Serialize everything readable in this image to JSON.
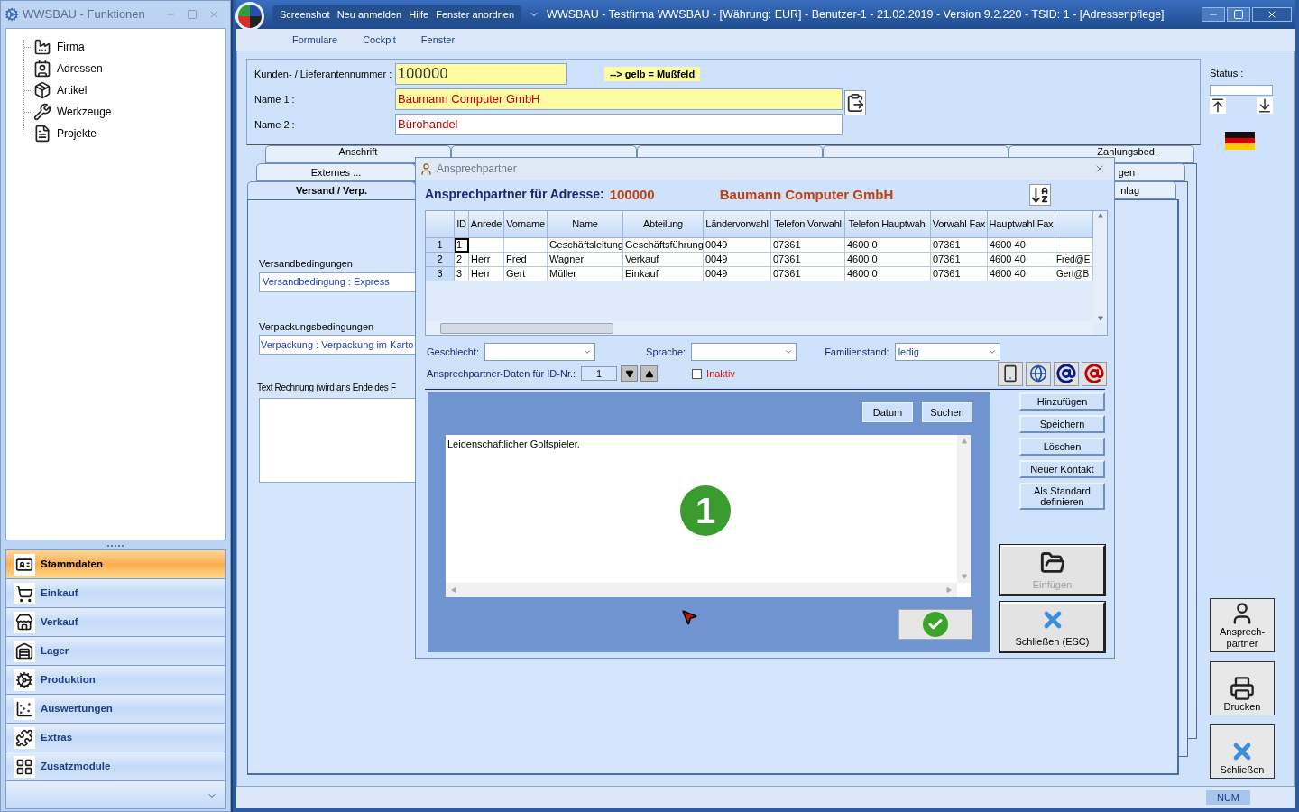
{
  "funktionen": {
    "title": "WWSBAU - Funktionen",
    "tree": [
      {
        "label": "Firma"
      },
      {
        "label": "Adressen"
      },
      {
        "label": "Artikel"
      },
      {
        "label": "Werkzeuge"
      },
      {
        "label": "Projekte"
      }
    ],
    "nav": [
      {
        "label": "Stammdaten",
        "selected": true
      },
      {
        "label": "Einkauf",
        "selected": false
      },
      {
        "label": "Verkauf",
        "selected": false
      },
      {
        "label": "Lager",
        "selected": false
      },
      {
        "label": "Produktion",
        "selected": false
      },
      {
        "label": "Auswertungen",
        "selected": false
      },
      {
        "label": "Extras",
        "selected": false
      },
      {
        "label": "Zusatzmodule",
        "selected": false
      }
    ]
  },
  "main": {
    "title_menu": [
      "Screenshot",
      "Neu anmelden",
      "Hilfe",
      "Fenster anordnen"
    ],
    "title": "WWSBAU - Testfirma WWSBAU - [Währung: EUR] - Benutzer-1 - 21.02.2019 - Version 9.2.220 - TSID: 1  - [Adressenpflege]",
    "menu": [
      "Formulare",
      "Cockpit",
      "Fenster"
    ],
    "form": {
      "customer_number": {
        "label": "Kunden- / Lieferantennummer :",
        "value": "100000"
      },
      "hint": "--> gelb = Mußfeld",
      "name1": {
        "label": "Name 1 :",
        "value": "Baumann Computer GmbH"
      },
      "name2": {
        "label": "Name 2 :",
        "value": "Bürohandel"
      },
      "status_label": "Status :"
    },
    "tab_rows": [
      [
        {
          "label": "Anschrift",
          "selected": false
        },
        {
          "selected": false
        },
        {
          "selected": false
        },
        {
          "selected": false
        },
        {
          "label": "Zahlungsbed.",
          "selected": false
        }
      ],
      [
        {
          "label": "Externes ...",
          "selected": false
        },
        {
          "label": "gen",
          "selected": false
        }
      ],
      [
        {
          "label": "Versand / Verp.",
          "selected": true
        },
        {
          "label": "nlag",
          "selected": false
        }
      ]
    ],
    "versand": {
      "shipping_label": "Versandbedingungen",
      "shipping_value": "Versandbedingung : Express",
      "packing_label": "Verpackungsbedingungen",
      "packing_value": "Verpackung :  Verpackung im Karto",
      "invoice_text_label": "Text Rechnung (wird ans Ende des F"
    },
    "side_buttons": [
      {
        "label": "Ansprech-partner",
        "kind": "person"
      },
      {
        "label": "Drucken",
        "kind": "print"
      },
      {
        "label": "Schließen",
        "kind": "close"
      }
    ],
    "status_bar": {
      "num": "NUM"
    }
  },
  "dialog": {
    "title": "Ansprechpartner",
    "header_label": "Ansprechpartner für Adresse:",
    "number": "100000",
    "company": "Baumann Computer GmbH",
    "columns": [
      {
        "label": "ID"
      },
      {
        "label": "Anrede"
      },
      {
        "label": "Vorname"
      },
      {
        "label": "Name"
      },
      {
        "label": "Abteilung"
      },
      {
        "label": "Ländervorwahl"
      },
      {
        "label": "Telefon Vorwahl"
      },
      {
        "label": "Telefon Hauptwahl"
      },
      {
        "label": "Vorwahl Fax"
      },
      {
        "label": "Hauptwahl Fax"
      }
    ],
    "rows": [
      {
        "number": "1",
        "focused": true,
        "cells": [
          "1",
          null,
          null,
          "Geschäftsleitung",
          "Geschäftsführung",
          "0049",
          "07361",
          "4600 0",
          "07361",
          "4600 40",
          null
        ]
      },
      {
        "number": "2",
        "focused": false,
        "cells": [
          "2",
          "Herr",
          "Fred",
          "Wagner",
          "Verkauf",
          "0049",
          "07361",
          "4600 0",
          "07361",
          "4600 40",
          "Fred@E"
        ]
      },
      {
        "number": "3",
        "focused": false,
        "cells": [
          "3",
          "Herr",
          "Gert",
          "Müller",
          "Einkauf",
          "0049",
          "07361",
          "4600 0",
          "07361",
          "4600 40",
          "Gert@B"
        ]
      }
    ],
    "gender": {
      "label": "Geschlecht:"
    },
    "language": {
      "label": "Sprache:"
    },
    "marital": {
      "label": "Familienstand:",
      "value": "ledig"
    },
    "id_label": "Ansprechpartner-Daten für ID-Nr.:",
    "id_value": "1",
    "inactive": {
      "label": "Inaktiv",
      "checked": false
    },
    "memo": {
      "buttons": [
        "Datum",
        "Suchen"
      ],
      "text": "Leidenschaftlicher Golfspieler.",
      "badge": "1"
    },
    "side_buttons": [
      {
        "label": "Hinzufügen"
      },
      {
        "label": "Speichern"
      },
      {
        "label": "Löschen"
      },
      {
        "label": "Neuer Kontakt"
      },
      {
        "label": "Als Standard definieren"
      }
    ],
    "big_buttons": [
      {
        "label": "Einfügen",
        "kind": "paste",
        "disabled": true
      },
      {
        "label": "Schließen (ESC)",
        "kind": "close",
        "disabled": false
      }
    ]
  }
}
